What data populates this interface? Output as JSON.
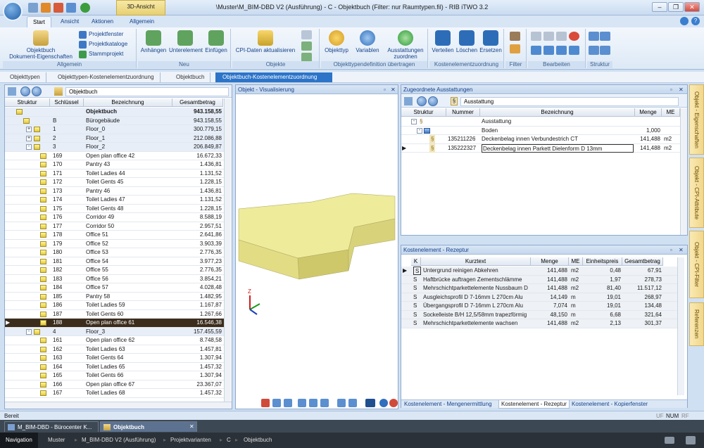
{
  "window": {
    "title": "\\Muster\\M_BIM-DBD V2 (Ausführung) - C - Objektbuch (Filter: nur Raumtypen.fil) - RIB iTWO 3.2",
    "context_tab": "3D-Ansicht"
  },
  "ribbon_tabs": [
    "Start",
    "Ansicht",
    "Aktionen",
    "Allgemein"
  ],
  "ribbon": {
    "allgemein": {
      "label": "Allgemein",
      "big_button": "Objektbuch\nDokument-Eigenschaften",
      "items": [
        "Projektfenster",
        "Projektkataloge",
        "Stammprojekt"
      ]
    },
    "neu": {
      "label": "Neu",
      "buttons": [
        "Anhängen",
        "Unterelement",
        "Einfügen"
      ]
    },
    "objekte": {
      "label": "Objekte",
      "buttons": [
        "CPI-Daten aktualisieren"
      ]
    },
    "typdef": {
      "label": "Objekttypendefinition übertragen",
      "buttons": [
        "Objekttyp",
        "Variablen",
        "Ausstattungen\nzuordnen"
      ]
    },
    "kez": {
      "label": "Kostenelementzuordnung",
      "buttons": [
        "Verteilen",
        "Löschen",
        "Ersetzen"
      ]
    },
    "filter": {
      "label": "Filter"
    },
    "bearbeiten": {
      "label": "Bearbeiten"
    },
    "struktur": {
      "label": "Struktur"
    }
  },
  "breadcrumb": [
    "Objekttypen",
    "Objekttypen-Kostenelementzuordnung",
    "Objektbuch",
    "Objektbuch-Kostenelementzuordnung"
  ],
  "left_panel": {
    "nav_label": "Objektbuch",
    "columns": [
      "Struktur",
      "Schlüssel",
      "Bezeichnung",
      "Gesamtbetrag"
    ],
    "rows": [
      {
        "key": "",
        "name": "Objektbuch",
        "amount": "943.158,55",
        "level": 0,
        "bold": true
      },
      {
        "key": "B",
        "name": "Bürogebäude",
        "amount": "943.158,55",
        "level": 1
      },
      {
        "key": "1",
        "name": "Floor_0",
        "amount": "300.779,15",
        "level": 2,
        "exp": "+"
      },
      {
        "key": "2",
        "name": "Floor_1",
        "amount": "212.086,88",
        "level": 2,
        "exp": "+"
      },
      {
        "key": "3",
        "name": "Floor_2",
        "amount": "206.849,87",
        "level": 2,
        "exp": "-"
      },
      {
        "key": "169",
        "name": "Open plan office 42",
        "amount": "16.672,33",
        "level": 3
      },
      {
        "key": "170",
        "name": "Pantry 43",
        "amount": "1.436,81",
        "level": 3
      },
      {
        "key": "171",
        "name": "Toilet Ladies 44",
        "amount": "1.131,52",
        "level": 3
      },
      {
        "key": "172",
        "name": "Toilet Gents 45",
        "amount": "1.228,15",
        "level": 3
      },
      {
        "key": "173",
        "name": "Pantry 46",
        "amount": "1.436,81",
        "level": 3
      },
      {
        "key": "174",
        "name": "Toilet Ladies 47",
        "amount": "1.131,52",
        "level": 3
      },
      {
        "key": "175",
        "name": "Toilet Gents 48",
        "amount": "1.228,15",
        "level": 3
      },
      {
        "key": "176",
        "name": "Corridor 49",
        "amount": "8.588,19",
        "level": 3
      },
      {
        "key": "177",
        "name": "Corridor 50",
        "amount": "2.957,51",
        "level": 3
      },
      {
        "key": "178",
        "name": "Office 51",
        "amount": "2.641,86",
        "level": 3
      },
      {
        "key": "179",
        "name": "Office 52",
        "amount": "3.903,39",
        "level": 3
      },
      {
        "key": "180",
        "name": "Office 53",
        "amount": "2.776,35",
        "level": 3
      },
      {
        "key": "181",
        "name": "Office 54",
        "amount": "3.977,23",
        "level": 3
      },
      {
        "key": "182",
        "name": "Office 55",
        "amount": "2.776,35",
        "level": 3
      },
      {
        "key": "183",
        "name": "Office 56",
        "amount": "3.854,21",
        "level": 3
      },
      {
        "key": "184",
        "name": "Office 57",
        "amount": "4.028,48",
        "level": 3
      },
      {
        "key": "185",
        "name": "Pantry 58",
        "amount": "1.482,95",
        "level": 3
      },
      {
        "key": "186",
        "name": "Toilet Ladies 59",
        "amount": "1.167,87",
        "level": 3
      },
      {
        "key": "187",
        "name": "Toilet Gents 60",
        "amount": "1.267,66",
        "level": 3
      },
      {
        "key": "188",
        "name": "Open plan office 61",
        "amount": "16.546,38",
        "level": 3,
        "selected": true
      },
      {
        "key": "4",
        "name": "Floor_3",
        "amount": "157.455,59",
        "level": 2,
        "exp": "-"
      },
      {
        "key": "161",
        "name": "Open plan office 62",
        "amount": "8.748,58",
        "level": 3
      },
      {
        "key": "162",
        "name": "Toilet Ladies 63",
        "amount": "1.457,81",
        "level": 3
      },
      {
        "key": "163",
        "name": "Toilet Gents 64",
        "amount": "1.307,94",
        "level": 3
      },
      {
        "key": "164",
        "name": "Toilet Ladies 65",
        "amount": "1.457,32",
        "level": 3
      },
      {
        "key": "165",
        "name": "Toilet Gents 66",
        "amount": "1.307,94",
        "level": 3
      },
      {
        "key": "166",
        "name": "Open plan office 67",
        "amount": "23.367,07",
        "level": 3
      },
      {
        "key": "167",
        "name": "Toilet Ladies 68",
        "amount": "1.457,32",
        "level": 3
      }
    ]
  },
  "center_panel": {
    "title": "Objekt - Visualisierung",
    "axis_z": "Z"
  },
  "ausstattungen": {
    "title": "Zugeordnete Ausstattungen",
    "nav_label": "Ausstattung",
    "columns": [
      "Struktur",
      "Nummer",
      "Bezeichnung",
      "Menge",
      "ME"
    ],
    "rows": [
      {
        "num": "",
        "name": "Ausstattung",
        "qty": "",
        "unit": ""
      },
      {
        "num": "",
        "name": "Boden",
        "qty": "1,000",
        "unit": ""
      },
      {
        "num": "135211226",
        "name": "Deckenbelag innen Verbundestrich CT",
        "qty": "141,488",
        "unit": "m2"
      },
      {
        "num": "135222327",
        "name": "Deckenbelag innen Parkett Dielenform D 13mm",
        "qty": "141,488",
        "unit": "m2",
        "selected": true
      }
    ]
  },
  "rezeptur": {
    "title": "Kostenelement - Rezeptur",
    "columns": [
      "K",
      "Kurztext",
      "Menge",
      "ME",
      "Einheitspreis",
      "Gesamtbetrag"
    ],
    "rows": [
      {
        "k": "S",
        "text": "Untergrund reinigen Abkehren",
        "qty": "141,488",
        "unit": "m2",
        "price": "0,48",
        "total": "67,91"
      },
      {
        "k": "S",
        "text": "Haftbrücke auftragen Zementschlämme",
        "qty": "141,488",
        "unit": "m2",
        "price": "1,97",
        "total": "278,73"
      },
      {
        "k": "S",
        "text": "Mehrschichtparkettelemente Nussbaum D 13",
        "qty": "141,488",
        "unit": "m2",
        "price": "81,40",
        "total": "11.517,12"
      },
      {
        "k": "S",
        "text": "Ausgleichsprofil D 7-16mm L 270cm Alu",
        "qty": "14,149",
        "unit": "m",
        "price": "19,01",
        "total": "268,97"
      },
      {
        "k": "S",
        "text": "Übergangsprofil D 7-16mm L 270cm Alu",
        "qty": "7,074",
        "unit": "m",
        "price": "19,01",
        "total": "134,48"
      },
      {
        "k": "S",
        "text": "Sockelleiste B/H 12,5/58mm trapezförmig",
        "qty": "48,150",
        "unit": "m",
        "price": "6,68",
        "total": "321,64"
      },
      {
        "k": "S",
        "text": "Mehrschichtparkettelemente wachsen",
        "qty": "141,488",
        "unit": "m2",
        "price": "2,13",
        "total": "301,37"
      }
    ],
    "bottom_tabs": [
      "Kostenelement - Mengenermittlung",
      "Kostenelement - Rezeptur",
      "Kostenelement - Kopierfenster"
    ]
  },
  "side_tabs": [
    "Objekt - Eigenschaften",
    "Objekt - CPI-Attribute",
    "Objekt - CPI-Filter",
    "Referenzen"
  ],
  "status": {
    "left": "Bereit",
    "right": [
      "UF",
      "NUM",
      "RF"
    ]
  },
  "doc_tabs": [
    "M_BIM-DBD - Bürocenter K...",
    "Objektbuch"
  ],
  "nav_path": [
    "Navigation",
    "Muster",
    "M_BIM-DBD V2 (Ausführung)",
    "Projektvarianten",
    "C",
    "Objektbuch"
  ]
}
